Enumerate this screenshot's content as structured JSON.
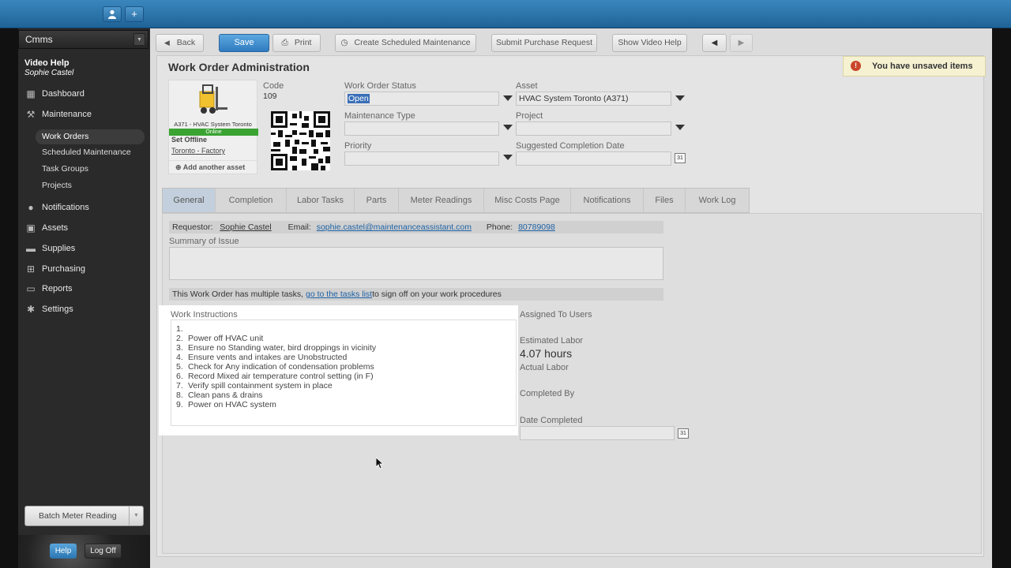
{
  "sidebar": {
    "app_select": "Cmms",
    "video_help": "Video Help",
    "user_name": "Sophie Castel",
    "nav": [
      {
        "label": "Dashboard",
        "icon": "home-icon"
      },
      {
        "label": "Maintenance",
        "icon": "wrench-icon"
      },
      {
        "label": "Notifications",
        "icon": "chat-bubble-icon"
      },
      {
        "label": "Assets",
        "icon": "box-icon"
      },
      {
        "label": "Supplies",
        "icon": "truck-icon"
      },
      {
        "label": "Purchasing",
        "icon": "cart-icon"
      },
      {
        "label": "Reports",
        "icon": "chart-icon"
      },
      {
        "label": "Settings",
        "icon": "gear-icon"
      }
    ],
    "maintenance_sub": [
      "Work Orders",
      "Scheduled Maintenance",
      "Task Groups",
      "Projects"
    ],
    "batch_meter": "Batch Meter Reading",
    "help": "Help",
    "log_off": "Log Off"
  },
  "toolbar": {
    "back": "Back",
    "save": "Save",
    "print": "Print",
    "create_sched": "Create Scheduled Maintenance",
    "submit_pr": "Submit Purchase Request",
    "show_help": "Show Video Help"
  },
  "page": {
    "title": "Work Order Administration",
    "unsaved": "You have unsaved items"
  },
  "asset_card": {
    "name": "A371 - HVAC System Toronto",
    "status": "Online",
    "set_offline": "Set Offline",
    "location": "Toronto - Factory",
    "add_asset": "Add another asset"
  },
  "form": {
    "code_label": "Code",
    "code_value": "109",
    "status_label": "Work Order Status",
    "status_value": "Open",
    "maint_type_label": "Maintenance Type",
    "maint_type_value": "",
    "priority_label": "Priority",
    "priority_value": "",
    "asset_label": "Asset",
    "asset_value": "HVAC System Toronto (A371)",
    "project_label": "Project",
    "project_value": "",
    "completion_label": "Suggested Completion Date",
    "completion_value": "",
    "cal_text": "31"
  },
  "tabs": [
    "General",
    "Completion",
    "Labor Tasks",
    "Parts",
    "Meter Readings",
    "Misc Costs Page",
    "Notifications",
    "Files",
    "Work Log"
  ],
  "general": {
    "requestor_label": "Requestor:",
    "requestor_value": "Sophie Castel",
    "email_label": "Email:",
    "email_value": "sophie.castel@maintenanceassistant.com",
    "phone_label": "Phone:",
    "phone_value": "80789098",
    "summary_label": "Summary of Issue",
    "tasks_note_pre": "This Work Order has multiple tasks,",
    "tasks_note_link": "go to the tasks list",
    "tasks_note_post": "to sign off on your work procedures",
    "wi_label": "Work Instructions",
    "instructions": [
      "",
      "Power off HVAC unit",
      "Ensure no Standing water, bird droppings in vicinity",
      "Ensure vents and intakes are Unobstructed",
      "Check for Any indication of condensation problems",
      "Record Mixed air temperature control setting (in F)",
      "Verify spill containment system in place",
      "Clean pans & drains",
      "Power on HVAC system"
    ],
    "assigned_users_label": "Assigned To Users",
    "est_labor_label": "Estimated Labor",
    "est_labor_value": "4.07 hours",
    "actual_labor_label": "Actual Labor",
    "completed_by_label": "Completed By",
    "date_completed_label": "Date Completed"
  }
}
